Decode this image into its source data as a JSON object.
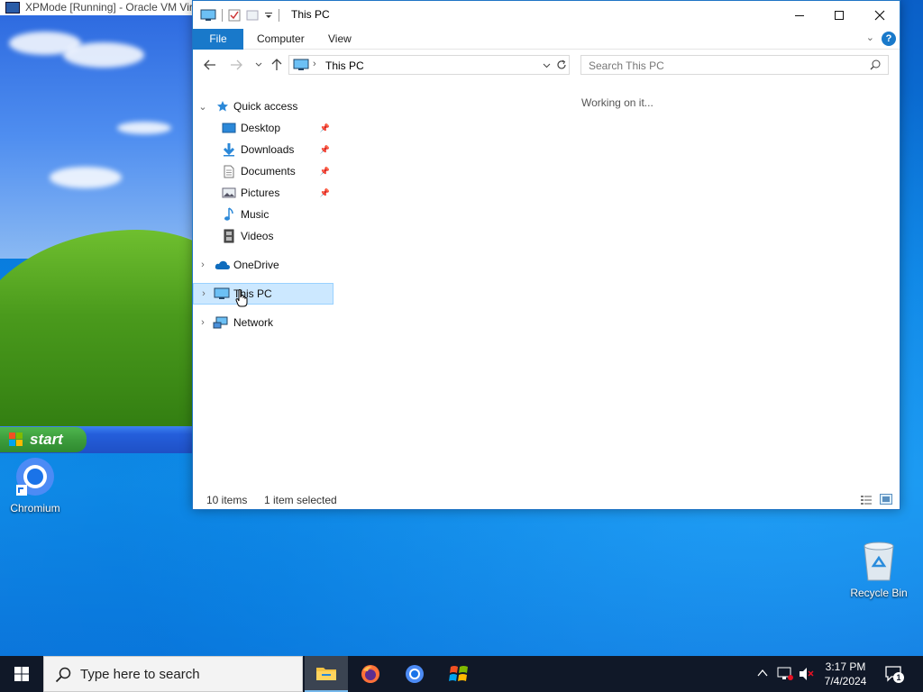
{
  "vm_window": {
    "title": "XPMode [Running] - Oracle VM VirtualBox",
    "start_label": "start"
  },
  "desktop": {
    "icons": [
      {
        "label": "Chromium"
      },
      {
        "label": "Recycle Bin"
      }
    ]
  },
  "explorer": {
    "title": "This PC",
    "tabs": {
      "file": "File",
      "computer": "Computer",
      "view": "View"
    },
    "help_label": "?",
    "address": "This PC",
    "search_placeholder": "Search This PC",
    "content_status": "Working on it...",
    "nav": {
      "quick_access": "Quick access",
      "desktop": "Desktop",
      "downloads": "Downloads",
      "documents": "Documents",
      "pictures": "Pictures",
      "music": "Music",
      "videos": "Videos",
      "onedrive": "OneDrive",
      "this_pc": "This PC",
      "network": "Network"
    },
    "status": {
      "items": "10 items",
      "selected": "1 item selected"
    }
  },
  "taskbar": {
    "search_placeholder": "Type here to search",
    "time": "3:17 PM",
    "date": "7/4/2024",
    "notification_count": "1"
  },
  "colors": {
    "accent": "#1979ca",
    "selection": "#cce8ff",
    "taskbar": "#101828"
  }
}
